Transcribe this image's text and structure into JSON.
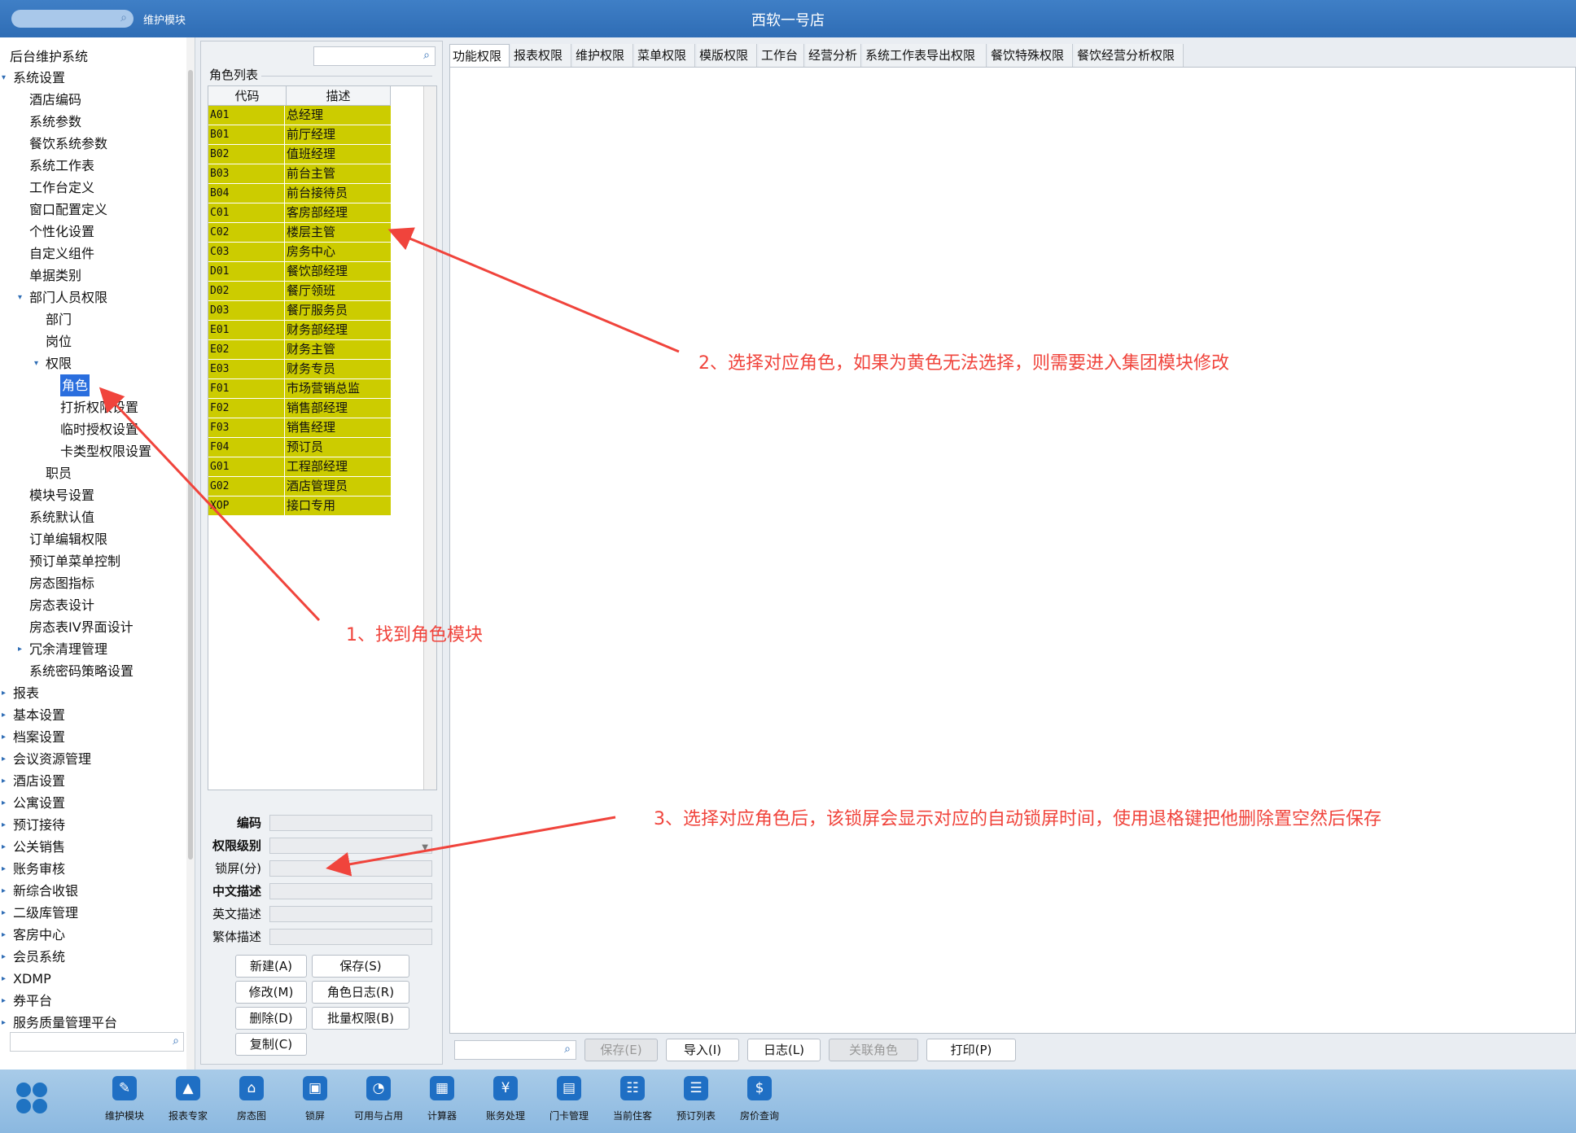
{
  "titlebar": {
    "module": "维护模块",
    "hotel": "西软一号店"
  },
  "sidebar": {
    "root": "后台维护系统",
    "items": [
      {
        "label": "系统设置",
        "level": 1,
        "arrow": "▾"
      },
      {
        "label": "酒店编码",
        "level": 2,
        "arrow": ""
      },
      {
        "label": "系统参数",
        "level": 2,
        "arrow": ""
      },
      {
        "label": "餐饮系统参数",
        "level": 2,
        "arrow": ""
      },
      {
        "label": "系统工作表",
        "level": 2,
        "arrow": ""
      },
      {
        "label": "工作台定义",
        "level": 2,
        "arrow": ""
      },
      {
        "label": "窗口配置定义",
        "level": 2,
        "arrow": ""
      },
      {
        "label": "个性化设置",
        "level": 2,
        "arrow": ""
      },
      {
        "label": "自定义组件",
        "level": 2,
        "arrow": ""
      },
      {
        "label": "单据类别",
        "level": 2,
        "arrow": ""
      },
      {
        "label": "部门人员权限",
        "level": 2,
        "arrow": "▾"
      },
      {
        "label": "部门",
        "level": 3,
        "arrow": ""
      },
      {
        "label": "岗位",
        "level": 3,
        "arrow": ""
      },
      {
        "label": "权限",
        "level": 3,
        "arrow": "▾"
      },
      {
        "label": "角色",
        "level": 4,
        "arrow": "",
        "selected": true
      },
      {
        "label": "打折权限设置",
        "level": 4,
        "arrow": ""
      },
      {
        "label": "临时授权设置",
        "level": 4,
        "arrow": ""
      },
      {
        "label": "卡类型权限设置",
        "level": 4,
        "arrow": ""
      },
      {
        "label": "职员",
        "level": 3,
        "arrow": ""
      },
      {
        "label": "模块号设置",
        "level": 2,
        "arrow": ""
      },
      {
        "label": "系统默认值",
        "level": 2,
        "arrow": ""
      },
      {
        "label": "订单编辑权限",
        "level": 2,
        "arrow": ""
      },
      {
        "label": "预订单菜单控制",
        "level": 2,
        "arrow": ""
      },
      {
        "label": "房态图指标",
        "level": 2,
        "arrow": ""
      },
      {
        "label": "房态表设计",
        "level": 2,
        "arrow": ""
      },
      {
        "label": "房态表IV界面设计",
        "level": 2,
        "arrow": ""
      },
      {
        "label": "冗余清理管理",
        "level": 2,
        "arrow": "▸"
      },
      {
        "label": "系统密码策略设置",
        "level": 2,
        "arrow": ""
      },
      {
        "label": "报表",
        "level": 1,
        "arrow": "▸"
      },
      {
        "label": "基本设置",
        "level": 1,
        "arrow": "▸"
      },
      {
        "label": "档案设置",
        "level": 1,
        "arrow": "▸"
      },
      {
        "label": "会议资源管理",
        "level": 1,
        "arrow": "▸"
      },
      {
        "label": "酒店设置",
        "level": 1,
        "arrow": "▸"
      },
      {
        "label": "公寓设置",
        "level": 1,
        "arrow": "▸"
      },
      {
        "label": "预订接待",
        "level": 1,
        "arrow": "▸"
      },
      {
        "label": "公关销售",
        "level": 1,
        "arrow": "▸"
      },
      {
        "label": "账务审核",
        "level": 1,
        "arrow": "▸"
      },
      {
        "label": "新综合收银",
        "level": 1,
        "arrow": "▸"
      },
      {
        "label": "二级库管理",
        "level": 1,
        "arrow": "▸"
      },
      {
        "label": "客房中心",
        "level": 1,
        "arrow": "▸"
      },
      {
        "label": "会员系统",
        "level": 1,
        "arrow": "▸"
      },
      {
        "label": "XDMP",
        "level": 1,
        "arrow": "▸"
      },
      {
        "label": "券平台",
        "level": 1,
        "arrow": "▸"
      },
      {
        "label": "服务质量管理平台",
        "level": 1,
        "arrow": "▸"
      }
    ]
  },
  "roles": {
    "list_title": "角色列表",
    "col_code": "代码",
    "col_desc": "描述",
    "rows": [
      {
        "code": "A01",
        "desc": "总经理"
      },
      {
        "code": "B01",
        "desc": "前厅经理"
      },
      {
        "code": "B02",
        "desc": "值班经理"
      },
      {
        "code": "B03",
        "desc": "前台主管"
      },
      {
        "code": "B04",
        "desc": "前台接待员"
      },
      {
        "code": "C01",
        "desc": "客房部经理"
      },
      {
        "code": "C02",
        "desc": "楼层主管"
      },
      {
        "code": "C03",
        "desc": "房务中心"
      },
      {
        "code": "D01",
        "desc": "餐饮部经理"
      },
      {
        "code": "D02",
        "desc": "餐厅领班"
      },
      {
        "code": "D03",
        "desc": "餐厅服务员"
      },
      {
        "code": "E01",
        "desc": "财务部经理"
      },
      {
        "code": "E02",
        "desc": "财务主管"
      },
      {
        "code": "E03",
        "desc": "财务专员"
      },
      {
        "code": "F01",
        "desc": "市场营销总监"
      },
      {
        "code": "F02",
        "desc": "销售部经理"
      },
      {
        "code": "F03",
        "desc": "销售经理"
      },
      {
        "code": "F04",
        "desc": "预订员"
      },
      {
        "code": "G01",
        "desc": "工程部经理"
      },
      {
        "code": "G02",
        "desc": "酒店管理员"
      },
      {
        "code": "XOP",
        "desc": "接口专用"
      }
    ],
    "form": {
      "code": "编码",
      "level": "权限级别",
      "lock": "锁屏(分)",
      "zh_desc": "中文描述",
      "en_desc": "英文描述",
      "tw_desc": "繁体描述"
    },
    "buttons": {
      "new": "新建(A)",
      "save": "保存(S)",
      "edit": "修改(M)",
      "role_log": "角色日志(R)",
      "delete": "删除(D)",
      "batch": "批量权限(B)",
      "copy": "复制(C)"
    }
  },
  "tabs": [
    "功能权限",
    "报表权限",
    "维护权限",
    "菜单权限",
    "模版权限",
    "工作台",
    "经营分析",
    "系统工作表导出权限",
    "餐饮特殊权限",
    "餐饮经营分析权限"
  ],
  "bottom_buttons": {
    "save": "保存(E)",
    "import": "导入(I)",
    "log": "日志(L)",
    "link_role": "关联角色",
    "print": "打印(P)"
  },
  "annotations": {
    "a1": "1、找到角色模块",
    "a2": "2、选择对应角色，如果为黄色无法选择，则需要进入集团模块修改",
    "a3": "3、选择对应角色后，该锁屏会显示对应的自动锁屏时间，使用退格键把他删除置空然后保存"
  },
  "taskbar": [
    {
      "label": "维护模块",
      "icon": "wrench-icon",
      "glyph": "✎"
    },
    {
      "label": "报表专家",
      "icon": "graduation-cap-icon",
      "glyph": "▲"
    },
    {
      "label": "房态图",
      "icon": "bank-icon",
      "glyph": "⌂"
    },
    {
      "label": "锁屏",
      "icon": "lock-icon",
      "glyph": "▣"
    },
    {
      "label": "可用与占用",
      "icon": "pie-chart-icon",
      "glyph": "◔"
    },
    {
      "label": "计算器",
      "icon": "calculator-icon",
      "glyph": "▦"
    },
    {
      "label": "账务处理",
      "icon": "money-icon",
      "glyph": "¥"
    },
    {
      "label": "门卡管理",
      "icon": "card-icon",
      "glyph": "▤"
    },
    {
      "label": "当前住客",
      "icon": "guest-card-icon",
      "glyph": "☷"
    },
    {
      "label": "预订列表",
      "icon": "booking-list-icon",
      "glyph": "☰"
    },
    {
      "label": "房价查询",
      "icon": "price-query-icon",
      "glyph": "$"
    }
  ],
  "colors": {
    "accent": "#2f6db5",
    "role_locked": "#cccc00",
    "annotation": "#f0443c"
  }
}
